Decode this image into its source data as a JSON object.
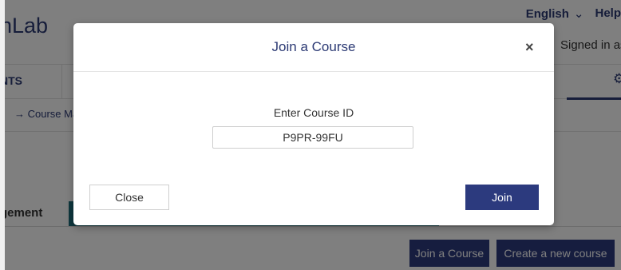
{
  "background": {
    "brand": "hLab",
    "language": "English",
    "help": "Help",
    "signed_in": "Signed in as",
    "nav_first": "NTS",
    "breadcrumb": "→ Course Ma",
    "section_label": "gement",
    "join_course_button": "Join a Course",
    "create_course_button": "Create a new course"
  },
  "modal": {
    "title": "Join a Course",
    "field_label": "Enter Course ID",
    "field_value": "P9PR-99FU",
    "close_label": "Close",
    "join_label": "Join",
    "close_icon": "×"
  },
  "icons": {
    "language_chevron": "chevron-down-icon",
    "settings": "gear-icon",
    "modal_close": "close-icon"
  },
  "colors": {
    "primary": "#2c3a7e",
    "teal": "#1c6f7c",
    "overlay": "rgba(0,0,0,0.5)"
  }
}
